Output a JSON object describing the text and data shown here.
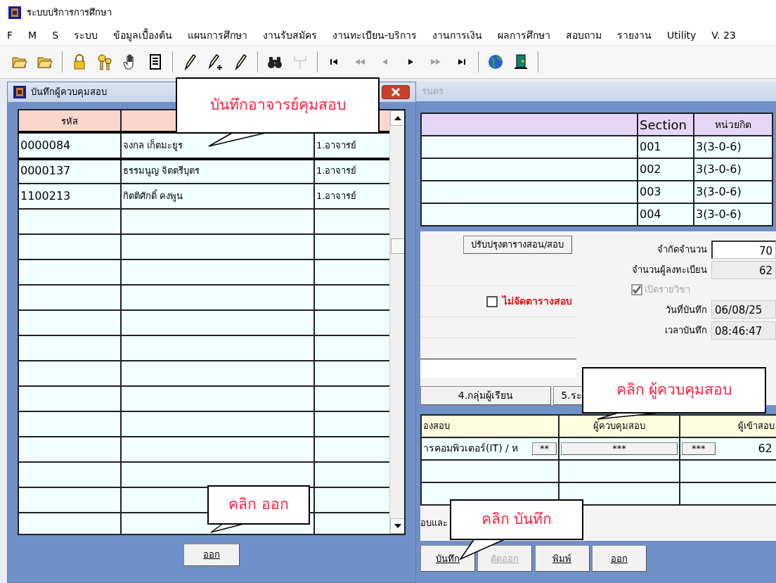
{
  "app": {
    "title": "ระบบบริการการศึกษา"
  },
  "menu": [
    "F",
    "M",
    "S",
    "ระบบ",
    "ข้อมูลเบื้องต้น",
    "แผนการศึกษา",
    "งานรับสมัคร",
    "งานทะเบียน-บริการ",
    "งานการเงิน",
    "ผลการศึกษา",
    "สอบถาม",
    "รายงาน",
    "Utility",
    "V. 23"
  ],
  "toolbar": [
    {
      "kind": "folder",
      "disabled": false
    },
    {
      "kind": "folder",
      "disabled": false
    },
    {
      "kind": "sep"
    },
    {
      "kind": "lock",
      "disabled": false
    },
    {
      "kind": "keys",
      "disabled": false
    },
    {
      "kind": "hand",
      "disabled": false
    },
    {
      "kind": "doc",
      "disabled": false
    },
    {
      "kind": "sep"
    },
    {
      "kind": "pencil",
      "disabled": false
    },
    {
      "kind": "pencilplus",
      "disabled": false
    },
    {
      "kind": "pencil",
      "disabled": false
    },
    {
      "kind": "sep"
    },
    {
      "kind": "binoculars",
      "disabled": false
    },
    {
      "kind": "fork",
      "disabled": true
    },
    {
      "kind": "sep"
    },
    {
      "kind": "first",
      "disabled": false
    },
    {
      "kind": "fastback",
      "disabled": true
    },
    {
      "kind": "back",
      "disabled": true
    },
    {
      "kind": "fwd",
      "disabled": false
    },
    {
      "kind": "fastfwd",
      "disabled": true
    },
    {
      "kind": "last",
      "disabled": false
    },
    {
      "kind": "sep"
    },
    {
      "kind": "globe",
      "disabled": false
    },
    {
      "kind": "door",
      "disabled": false
    },
    {
      "kind": "sep"
    }
  ],
  "background_window": {
    "title": "รนตร",
    "sections_table": {
      "columns": [
        "Section",
        "หน่วยกิต"
      ],
      "rows": [
        {
          "section": "001",
          "credits": "3(3-0-6)"
        },
        {
          "section": "002",
          "credits": "3(3-0-6)"
        },
        {
          "section": "003",
          "credits": "3(3-0-6)"
        },
        {
          "section": "004",
          "credits": "3(3-0-6)"
        }
      ]
    },
    "update_button": "ปรับปรุงตารางสอน/สอบ",
    "no_exam_checkbox": {
      "label": "ไม่จัดตารางสอบ",
      "checked": false
    },
    "fields": [
      {
        "label": "จำกัดจำนวน",
        "value": "70",
        "editable": true
      },
      {
        "label": "จำนวนผู้ลงทะเบียน",
        "value": "62",
        "editable": false
      }
    ],
    "open_course_checkbox": {
      "label": "เปิดรายวิชา",
      "checked": true,
      "disabled": true
    },
    "record_fields": [
      {
        "label": "วันที่บันทึก",
        "value": "06/08/25"
      },
      {
        "label": "เวลาบันทึก",
        "value": "08:46:47"
      }
    ],
    "tabs": [
      "4.กลุ่มผู้เรียน",
      "5.ระ"
    ],
    "exam_table": {
      "columns": [
        "องสอบ",
        "ผู้ควบคุมสอบ",
        "ผู้เข้าสอบ"
      ],
      "rows": [
        {
          "room": "ารคอมพิวเตอร์(IT) / ห",
          "room_button": "**",
          "proctor_button": "***",
          "examinee_button": "***",
          "count": "62"
        }
      ]
    },
    "note": "อบและ",
    "buttons": [
      {
        "label": "บันทึก",
        "disabled": false
      },
      {
        "label": "ตัดออก",
        "disabled": true
      },
      {
        "label": "พิมพ์",
        "disabled": false
      },
      {
        "label": "ออก",
        "disabled": false
      }
    ]
  },
  "dialog": {
    "title": "บันทึกผู้ควบคุมสอบ",
    "columns": [
      "รหัส"
    ],
    "rows": [
      {
        "code": "0000084",
        "name": "จงกล เก็ตมะยูร",
        "position": "1.อาจารย์",
        "selected": true
      },
      {
        "code": "0000137",
        "name": "ธรรมนูญ จิตตรีบุตร",
        "position": "1.อาจารย์",
        "selected": false
      },
      {
        "code": "1100213",
        "name": "กิตติศักดิ์ คงพูน",
        "position": "1.อาจารย์",
        "selected": false
      }
    ],
    "exit_button": "ออก"
  },
  "callouts": [
    {
      "text": "บันทึกอาจารย์คุมสอบ"
    },
    {
      "text": "คลิก ผู้ควบคุมสอบ"
    },
    {
      "text": "คลิก ออก"
    },
    {
      "text": "คลิก บันทึก"
    }
  ]
}
